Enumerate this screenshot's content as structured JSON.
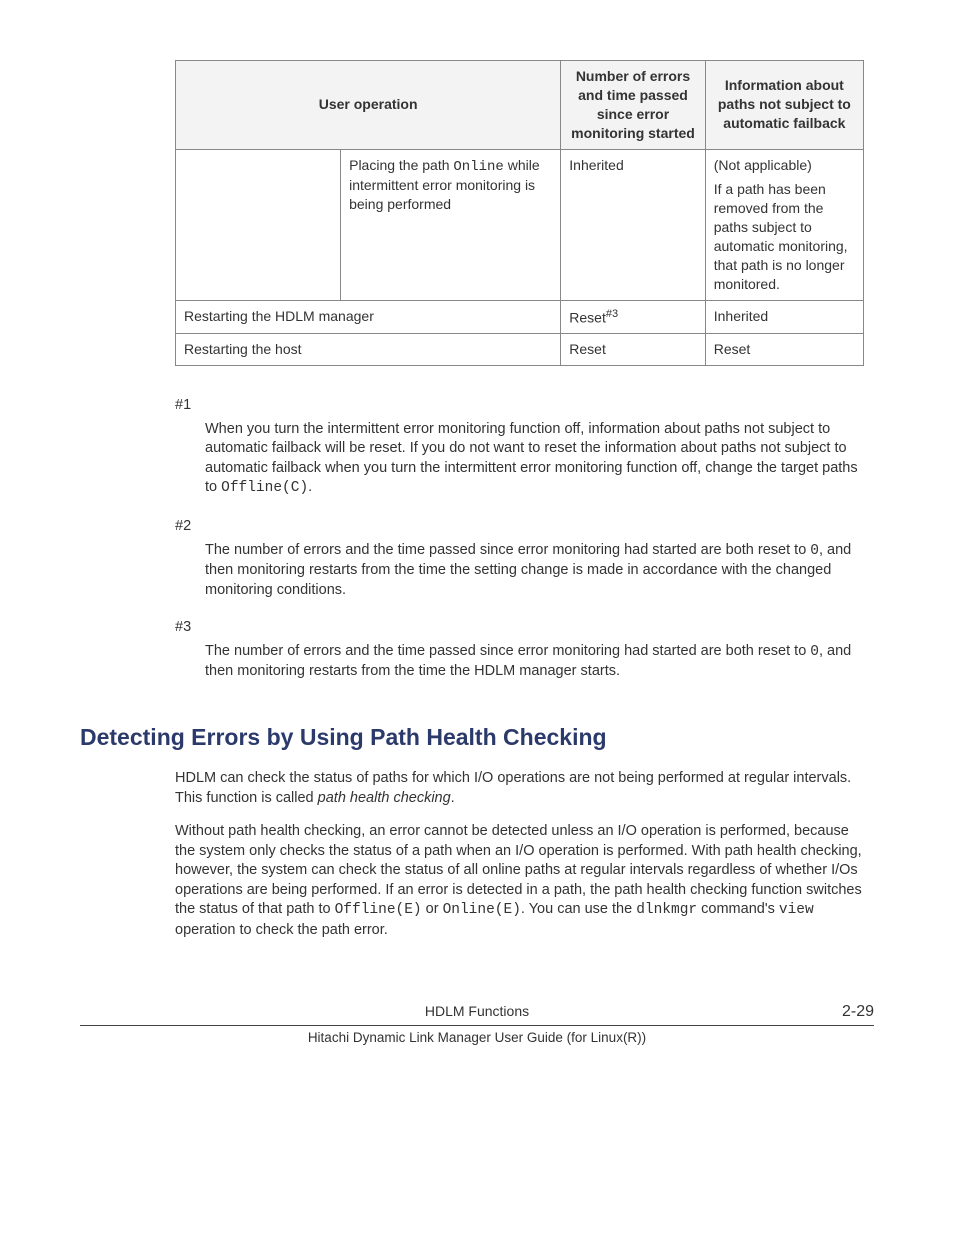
{
  "table": {
    "headers": {
      "col1": "User operation",
      "col2": "Number of errors and time passed since error monitoring started",
      "col3": "Information about paths not subject to automatic failback"
    },
    "rows": {
      "r1": {
        "op_pre": "Placing the path ",
        "op_code": "Online",
        "op_post": " while intermittent error monitoring is being performed",
        "col2": "Inherited",
        "col3a": "(Not applicable)",
        "col3b": "If a path has been removed from the paths subject to automatic monitoring, that path is no longer monitored."
      },
      "r2": {
        "op": "Restarting the HDLM manager",
        "col2_pre": "Reset",
        "col2_sup": "#3",
        "col3": "Inherited"
      },
      "r3": {
        "op": "Restarting the host",
        "col2": "Reset",
        "col3": "Reset"
      }
    }
  },
  "notes": {
    "n1": {
      "label": "#1",
      "text_a": "When you turn the intermittent error monitoring function off, information about paths not subject to automatic failback will be reset. If you do not want to reset the information about paths not subject to automatic failback when you turn the intermittent error monitoring function off, change the target paths to ",
      "code": "Offline(C)",
      "text_b": "."
    },
    "n2": {
      "label": "#2",
      "text_a": "The number of errors and the time passed since error monitoring had started are both reset to ",
      "code": "0",
      "text_b": ", and then monitoring restarts from the time the setting change is made in accordance with the changed monitoring conditions."
    },
    "n3": {
      "label": "#3",
      "text_a": "The number of errors and the time passed since error monitoring had started are both reset to ",
      "code": "0",
      "text_b": ", and then monitoring restarts from the time the HDLM manager starts."
    }
  },
  "section": {
    "heading": "Detecting Errors by Using Path Health Checking",
    "p1_a": "HDLM can check the status of paths for which I/O operations are not being performed at regular intervals. This function is called ",
    "p1_i": "path health checking",
    "p1_b": ".",
    "p2_a": "Without path health checking, an error cannot be detected unless an I/O operation is performed, because the system only checks the status of a path when an I/O operation is performed. With path health checking, however, the system can check the status of all online paths at regular intervals regardless of whether I/Os operations are being performed. If an error is detected in a path, the path health checking function switches the status of that path to ",
    "p2_code1": "Offline(E)",
    "p2_b": " or ",
    "p2_code2": "Online(E)",
    "p2_c": ". You can use the ",
    "p2_code3": "dlnkmgr",
    "p2_d": " command's ",
    "p2_code4": "view",
    "p2_e": " operation to check the path error."
  },
  "footer": {
    "title": "HDLM Functions",
    "page": "2-29",
    "sub": "Hitachi Dynamic Link Manager User Guide (for Linux(R))"
  }
}
